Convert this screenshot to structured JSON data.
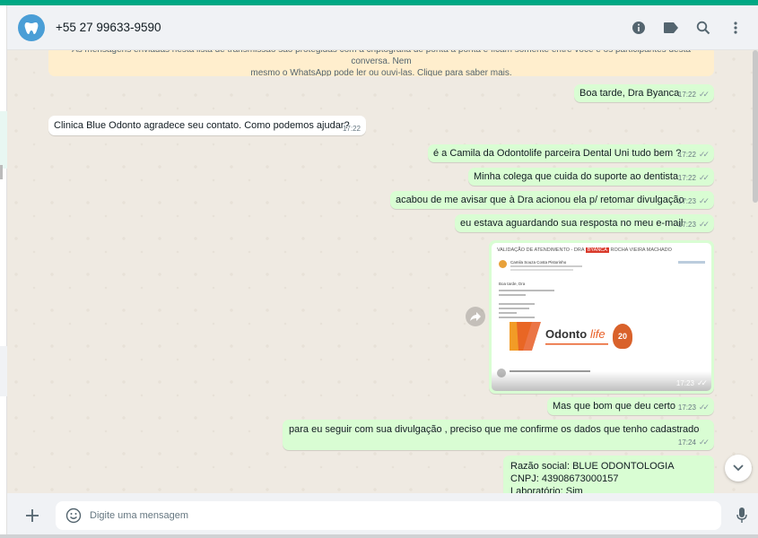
{
  "header": {
    "contact_name": "+55 27 99633-9590"
  },
  "notice": {
    "line1": "As mensagens enviadas nesta lista de transmissão são protegidas com a criptografia de ponta a ponta e ficam somente entre você e os participantes desta conversa. Nem",
    "line2": "mesmo o WhatsApp pode ler ou ouvi-las. Clique para saber mais."
  },
  "messages": [
    {
      "dir": "out",
      "text": "Boa tarde, Dra Byanca",
      "time": "17:22"
    },
    {
      "dir": "in",
      "text": "Clinica Blue Odonto agradece seu contato. Como podemos ajudar?",
      "time": "17:22"
    },
    {
      "dir": "out",
      "text": "é a Camila da Odontolife parceira Dental Uni tudo bem ?",
      "time": "17:22"
    },
    {
      "dir": "out",
      "text": "Minha colega que cuida do suporte ao dentista",
      "time": "17:22"
    },
    {
      "dir": "out",
      "text": "acabou de me avisar que à Dra acionou ela p/ retomar divulgação",
      "time": "17:23"
    },
    {
      "dir": "out",
      "text": "eu estava aguardando sua resposta no meu e-mail",
      "time": "17:23"
    },
    {
      "dir": "out",
      "text": "Mas que bom que deu certo",
      "time": "17:23"
    },
    {
      "dir": "out",
      "text": "para eu seguir com sua divulgação , preciso que me confirme os dados que tenho cadastrado",
      "time": "17:24"
    }
  ],
  "image_message": {
    "time": "17:23",
    "doc_title_prefix": "VALIDAÇÃO DE ATENDIMENTO - DRA ",
    "doc_title_highlight": "BYANCA",
    "doc_title_suffix": " ROCHA VIEIRA MACHADO",
    "doc_sender": "Camila Souza Costa Pistorinho",
    "doc_greeting": "Boa tarde, Dra",
    "doc_brand": "Odontolife",
    "doc_seal": "20"
  },
  "last_message": {
    "lines": [
      "Razão social: BLUE ODONTOLOGIA",
      "CNPJ: 43908673000157",
      "Laboratório: Sim"
    ]
  },
  "composer": {
    "placeholder": "Digite uma mensagem"
  },
  "colors": {
    "accent": "#00a884",
    "outgoing_bubble": "#d9fdd3",
    "incoming_bubble": "#ffffff",
    "chat_bg": "#efeae2"
  }
}
